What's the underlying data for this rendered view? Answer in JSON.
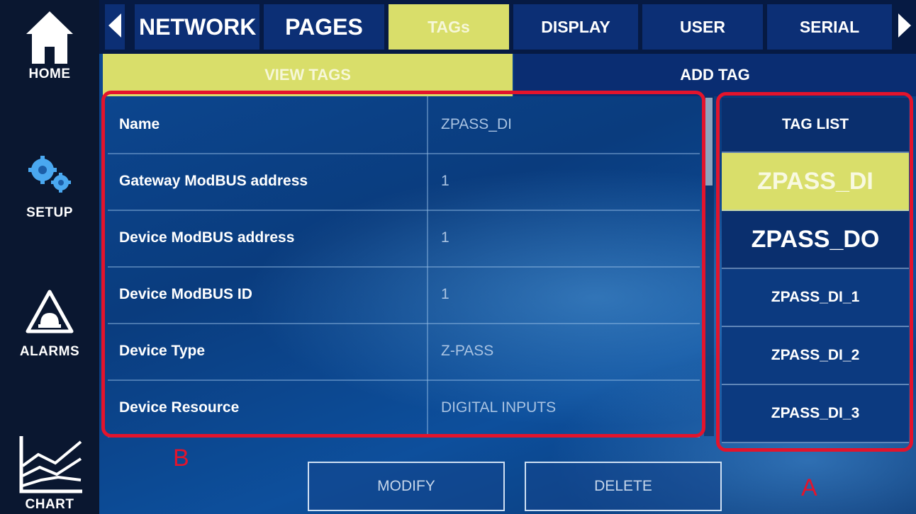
{
  "sidebar": {
    "home": {
      "label": "HOME",
      "icon": "house-icon"
    },
    "setup": {
      "label": "SETUP",
      "icon": "gears-icon"
    },
    "alarms": {
      "label": "ALARMS",
      "icon": "alarm-bell-icon"
    },
    "chart": {
      "label": "CHART",
      "icon": "line-chart-icon"
    }
  },
  "tabs": [
    {
      "label": "NETWORK",
      "active": false
    },
    {
      "label": "PAGES",
      "active": false
    },
    {
      "label": "TAGs",
      "active": true
    },
    {
      "label": "DISPLAY",
      "active": false
    },
    {
      "label": "USER",
      "active": false
    },
    {
      "label": "SERIAL",
      "active": false
    }
  ],
  "subtabs": {
    "view": {
      "label": "VIEW TAGS",
      "active": true
    },
    "add": {
      "label": "ADD TAG",
      "active": false
    }
  },
  "form": {
    "rows": [
      {
        "label": "Name",
        "value": "ZPASS_DI"
      },
      {
        "label": "Gateway ModBUS address",
        "value": "1"
      },
      {
        "label": "Device ModBUS address",
        "value": "1"
      },
      {
        "label": "Device ModBUS ID",
        "value": "1"
      },
      {
        "label": "Device Type",
        "value": "Z-PASS"
      },
      {
        "label": "Device Resource",
        "value": "DIGITAL INPUTS"
      }
    ]
  },
  "tag_list": {
    "header": "TAG LIST",
    "items": [
      {
        "label": "ZPASS_DI",
        "selected": true
      },
      {
        "label": "ZPASS_DO",
        "selected": false
      },
      {
        "label": "ZPASS_DI_1",
        "selected": false
      },
      {
        "label": "ZPASS_DI_2",
        "selected": false
      },
      {
        "label": "ZPASS_DI_3",
        "selected": false
      }
    ]
  },
  "actions": {
    "modify": "MODIFY",
    "delete": "DELETE"
  },
  "callouts": {
    "a": "A",
    "b": "B"
  },
  "colors": {
    "active_tab": "#d9de6a",
    "tab": "#0c2f75",
    "callout": "#e3142c",
    "sidebar": "#0a1730"
  }
}
